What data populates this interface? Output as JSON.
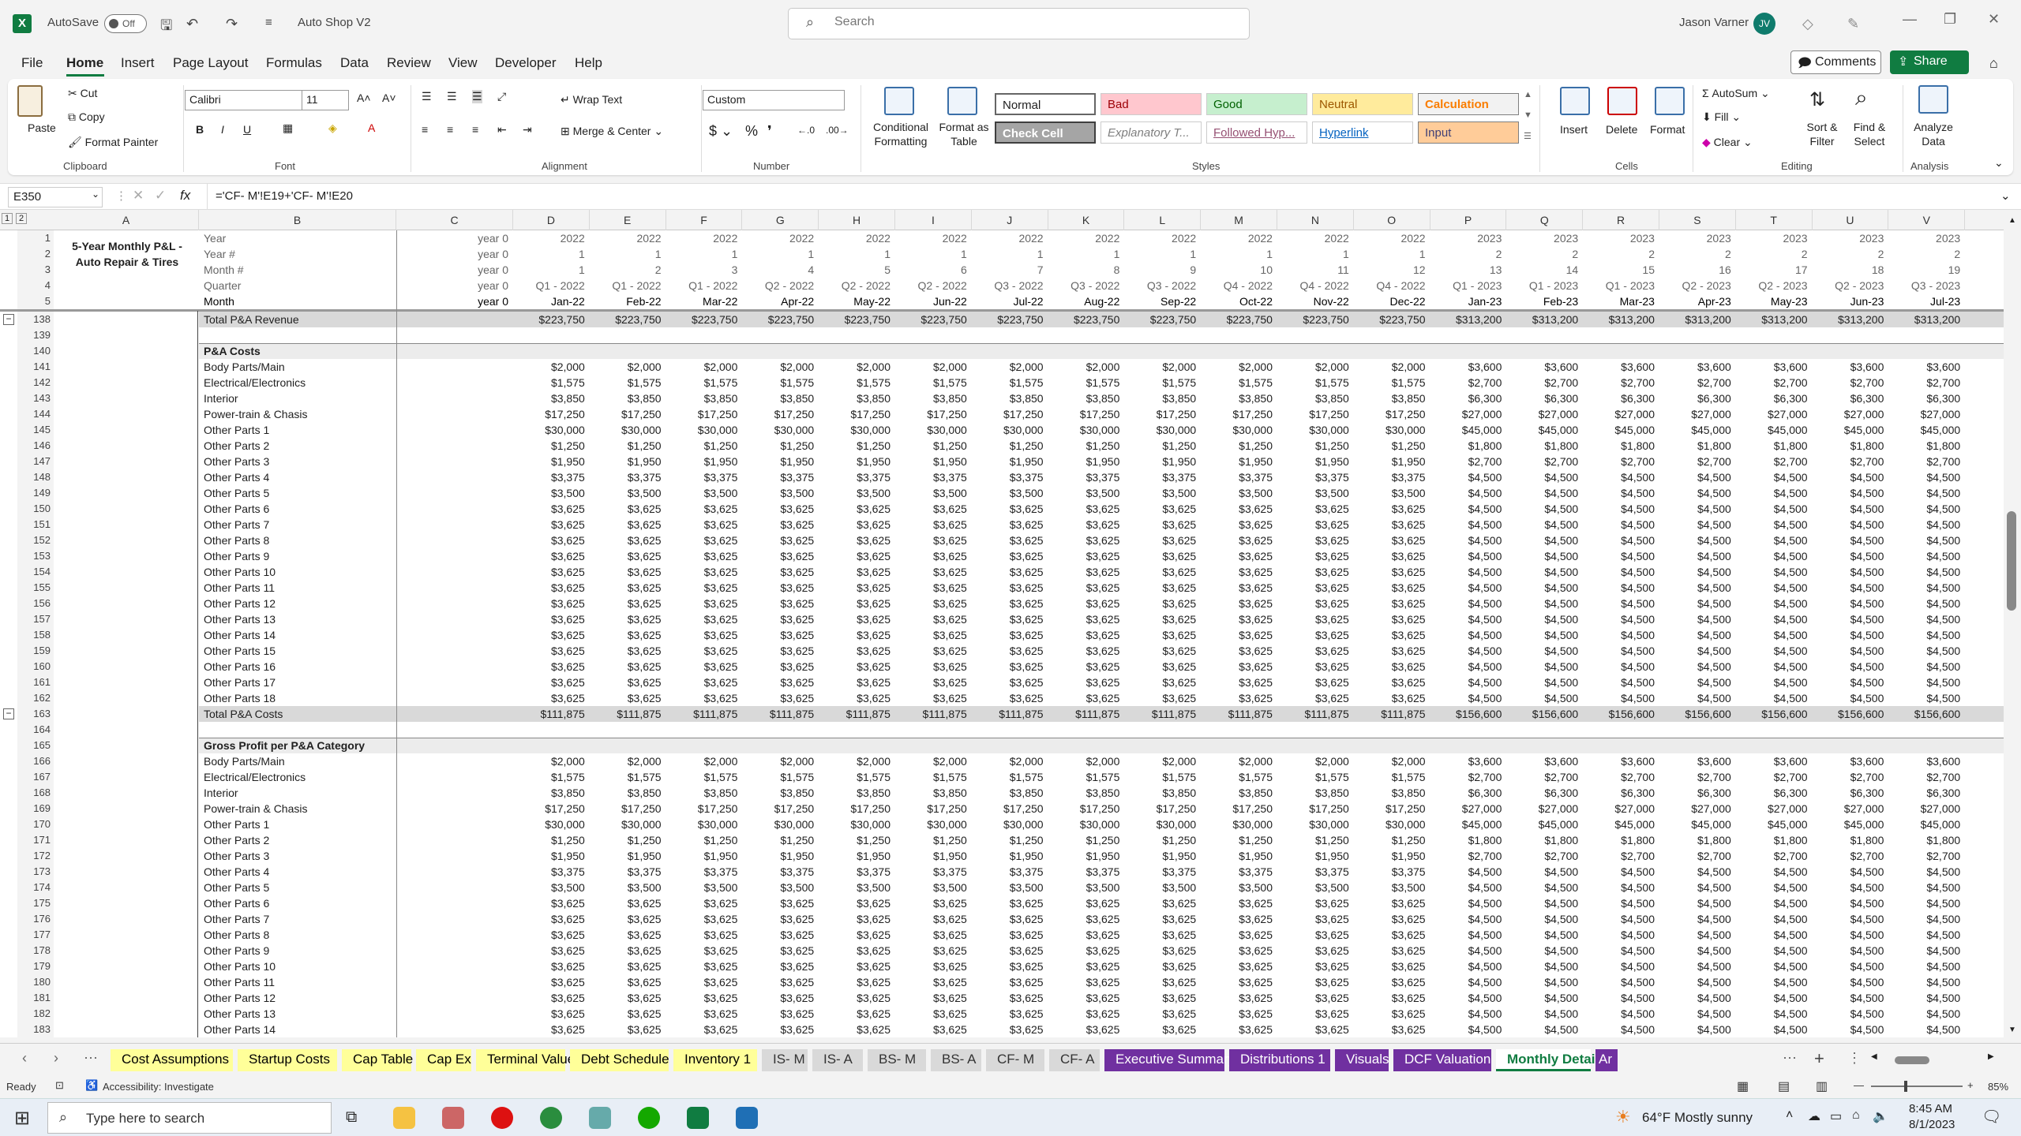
{
  "titlebar": {
    "autosave_label": "AutoSave",
    "autosave_state": "Off",
    "filename": "Auto Shop V2",
    "search_placeholder": "Search",
    "user_name": "Jason Varner",
    "user_initials": "JV"
  },
  "menu": {
    "tabs": [
      "File",
      "Home",
      "Insert",
      "Page Layout",
      "Formulas",
      "Data",
      "Review",
      "View",
      "Developer",
      "Help"
    ],
    "active": "Home",
    "comments": "Comments",
    "share": "Share"
  },
  "ribbon": {
    "clipboard": {
      "paste": "Paste",
      "cut": "Cut",
      "copy": "Copy",
      "format_painter": "Format Painter",
      "group": "Clipboard"
    },
    "font": {
      "name": "Calibri",
      "size": "11",
      "group": "Font"
    },
    "alignment": {
      "wrap": "Wrap Text",
      "merge": "Merge & Center",
      "group": "Alignment"
    },
    "number": {
      "format": "Custom",
      "group": "Number"
    },
    "styles": {
      "cond": "Conditional Formatting",
      "fmt_table": "Format as Table",
      "normal": "Normal",
      "bad": "Bad",
      "good": "Good",
      "neutral": "Neutral",
      "calculation": "Calculation",
      "check_cell": "Check Cell",
      "explanatory": "Explanatory T...",
      "followed": "Followed Hyp...",
      "hyperlink": "Hyperlink",
      "input": "Input",
      "group": "Styles"
    },
    "cells": {
      "insert": "Insert",
      "delete": "Delete",
      "format": "Format",
      "group": "Cells"
    },
    "editing": {
      "autosum": "AutoSum",
      "fill": "Fill",
      "clear": "Clear",
      "sort": "Sort & Filter",
      "find": "Find & Select",
      "group": "Editing"
    },
    "analysis": {
      "analyze": "Analyze Data",
      "group": "Analysis"
    }
  },
  "formula_bar": {
    "name_box": "E350",
    "formula": "='CF- M'!E19+'CF- M'!E20"
  },
  "colors": {
    "excel_green": "#107c41",
    "tab_yellow": "#ffff99",
    "tab_grey": "#d9d9d9",
    "tab_purple": "#7030a0",
    "header_grey": "#d9d9d9"
  },
  "sheet": {
    "title": "5-Year Monthly P&L - Auto Repair & Tires",
    "columns": [
      "A",
      "B",
      "C",
      "D",
      "E",
      "F",
      "G",
      "H",
      "I",
      "J",
      "K",
      "L",
      "M",
      "N",
      "O",
      "P",
      "Q",
      "R",
      "S",
      "T",
      "U",
      "V"
    ],
    "header_rows": [
      {
        "row": "1",
        "label": "Year",
        "c": "year 0",
        "values": [
          "2022",
          "2022",
          "2022",
          "2022",
          "2022",
          "2022",
          "2022",
          "2022",
          "2022",
          "2022",
          "2022",
          "2022",
          "2023",
          "2023",
          "2023",
          "2023",
          "2023",
          "2023",
          "2023"
        ]
      },
      {
        "row": "2",
        "label": "Year #",
        "c": "year 0",
        "values": [
          "1",
          "1",
          "1",
          "1",
          "1",
          "1",
          "1",
          "1",
          "1",
          "1",
          "1",
          "1",
          "2",
          "2",
          "2",
          "2",
          "2",
          "2",
          "2"
        ]
      },
      {
        "row": "3",
        "label": "Month #",
        "c": "year 0",
        "values": [
          "1",
          "2",
          "3",
          "4",
          "5",
          "6",
          "7",
          "8",
          "9",
          "10",
          "11",
          "12",
          "13",
          "14",
          "15",
          "16",
          "17",
          "18",
          "19"
        ]
      },
      {
        "row": "4",
        "label": "Quarter",
        "c": "year 0",
        "values": [
          "Q1 - 2022",
          "Q1 - 2022",
          "Q1 - 2022",
          "Q2 - 2022",
          "Q2 - 2022",
          "Q2 - 2022",
          "Q3 - 2022",
          "Q3 - 2022",
          "Q3 - 2022",
          "Q4 - 2022",
          "Q4 - 2022",
          "Q4 - 2022",
          "Q1 - 2023",
          "Q1 - 2023",
          "Q1 - 2023",
          "Q2 - 2023",
          "Q2 - 2023",
          "Q2 - 2023",
          "Q3 - 2023"
        ]
      },
      {
        "row": "5",
        "label": "Month",
        "c": "year 0",
        "values": [
          "Jan-22",
          "Feb-22",
          "Mar-22",
          "Apr-22",
          "May-22",
          "Jun-22",
          "Jul-22",
          "Aug-22",
          "Sep-22",
          "Oct-22",
          "Nov-22",
          "Dec-22",
          "Jan-23",
          "Feb-23",
          "Mar-23",
          "Apr-23",
          "May-23",
          "Jun-23",
          "Jul-23"
        ]
      }
    ],
    "total_revenue": {
      "row": "138",
      "label": "Total P&A Revenue",
      "y1": "$223,750",
      "y2": "$313,200"
    },
    "section1": {
      "row": "140",
      "label": "P&A Costs"
    },
    "section2": {
      "row": "165",
      "label": "Gross Profit per P&A Category"
    },
    "total_costs": {
      "row": "163",
      "label": "Total P&A Costs",
      "y1": "$111,875",
      "y2": "$156,600"
    },
    "cost_items": [
      {
        "label": "Body Parts/Main",
        "y1": "$2,000",
        "y2": "$3,600"
      },
      {
        "label": "Electrical/Electronics",
        "y1": "$1,575",
        "y2": "$2,700"
      },
      {
        "label": "Interior",
        "y1": "$3,850",
        "y2": "$6,300"
      },
      {
        "label": "Power-train & Chasis",
        "y1": "$17,250",
        "y2": "$27,000"
      },
      {
        "label": "Other Parts 1",
        "y1": "$30,000",
        "y2": "$45,000"
      },
      {
        "label": "Other Parts 2",
        "y1": "$1,250",
        "y2": "$1,800"
      },
      {
        "label": "Other Parts 3",
        "y1": "$1,950",
        "y2": "$2,700"
      },
      {
        "label": "Other Parts 4",
        "y1": "$3,375",
        "y2": "$4,500"
      },
      {
        "label": "Other Parts 5",
        "y1": "$3,500",
        "y2": "$4,500"
      },
      {
        "label": "Other Parts 6",
        "y1": "$3,625",
        "y2": "$4,500"
      },
      {
        "label": "Other Parts 7",
        "y1": "$3,625",
        "y2": "$4,500"
      },
      {
        "label": "Other Parts 8",
        "y1": "$3,625",
        "y2": "$4,500"
      },
      {
        "label": "Other Parts 9",
        "y1": "$3,625",
        "y2": "$4,500"
      },
      {
        "label": "Other Parts 10",
        "y1": "$3,625",
        "y2": "$4,500"
      },
      {
        "label": "Other Parts 11",
        "y1": "$3,625",
        "y2": "$4,500"
      },
      {
        "label": "Other Parts 12",
        "y1": "$3,625",
        "y2": "$4,500"
      },
      {
        "label": "Other Parts 13",
        "y1": "$3,625",
        "y2": "$4,500"
      },
      {
        "label": "Other Parts 14",
        "y1": "$3,625",
        "y2": "$4,500"
      },
      {
        "label": "Other Parts 15",
        "y1": "$3,625",
        "y2": "$4,500"
      },
      {
        "label": "Other Parts 16",
        "y1": "$3,625",
        "y2": "$4,500"
      },
      {
        "label": "Other Parts 17",
        "y1": "$3,625",
        "y2": "$4,500"
      },
      {
        "label": "Other Parts 18",
        "y1": "$3,625",
        "y2": "$4,500"
      }
    ],
    "gp_count": 18
  },
  "sheet_tabs": [
    {
      "name": "Cost Assumptions",
      "color": "yellow"
    },
    {
      "name": "Startup Costs",
      "color": "yellow"
    },
    {
      "name": "Cap Table",
      "color": "yellow"
    },
    {
      "name": "Cap Ex",
      "color": "yellow"
    },
    {
      "name": "Terminal Value",
      "color": "yellow"
    },
    {
      "name": "Debt Schedule",
      "color": "yellow"
    },
    {
      "name": "Inventory 1",
      "color": "yellow"
    },
    {
      "name": "IS- M",
      "color": "grey"
    },
    {
      "name": "IS- A",
      "color": "grey"
    },
    {
      "name": "BS- M",
      "color": "grey"
    },
    {
      "name": "BS- A",
      "color": "grey"
    },
    {
      "name": "CF- M",
      "color": "grey"
    },
    {
      "name": "CF- A",
      "color": "grey"
    },
    {
      "name": "Executive Summary",
      "color": "purple"
    },
    {
      "name": "Distributions 1",
      "color": "purple"
    },
    {
      "name": "Visuals",
      "color": "purple"
    },
    {
      "name": "DCF Valuation",
      "color": "purple"
    },
    {
      "name": "Monthly Detail",
      "color": "active"
    },
    {
      "name": "Ar",
      "color": "purple"
    }
  ],
  "status": {
    "ready": "Ready",
    "accessibility": "Accessibility: Investigate",
    "zoom": "85%"
  },
  "taskbar": {
    "search_placeholder": "Type here to search",
    "weather": "64°F  Mostly sunny",
    "time": "8:45 AM",
    "date": "8/1/2023"
  }
}
